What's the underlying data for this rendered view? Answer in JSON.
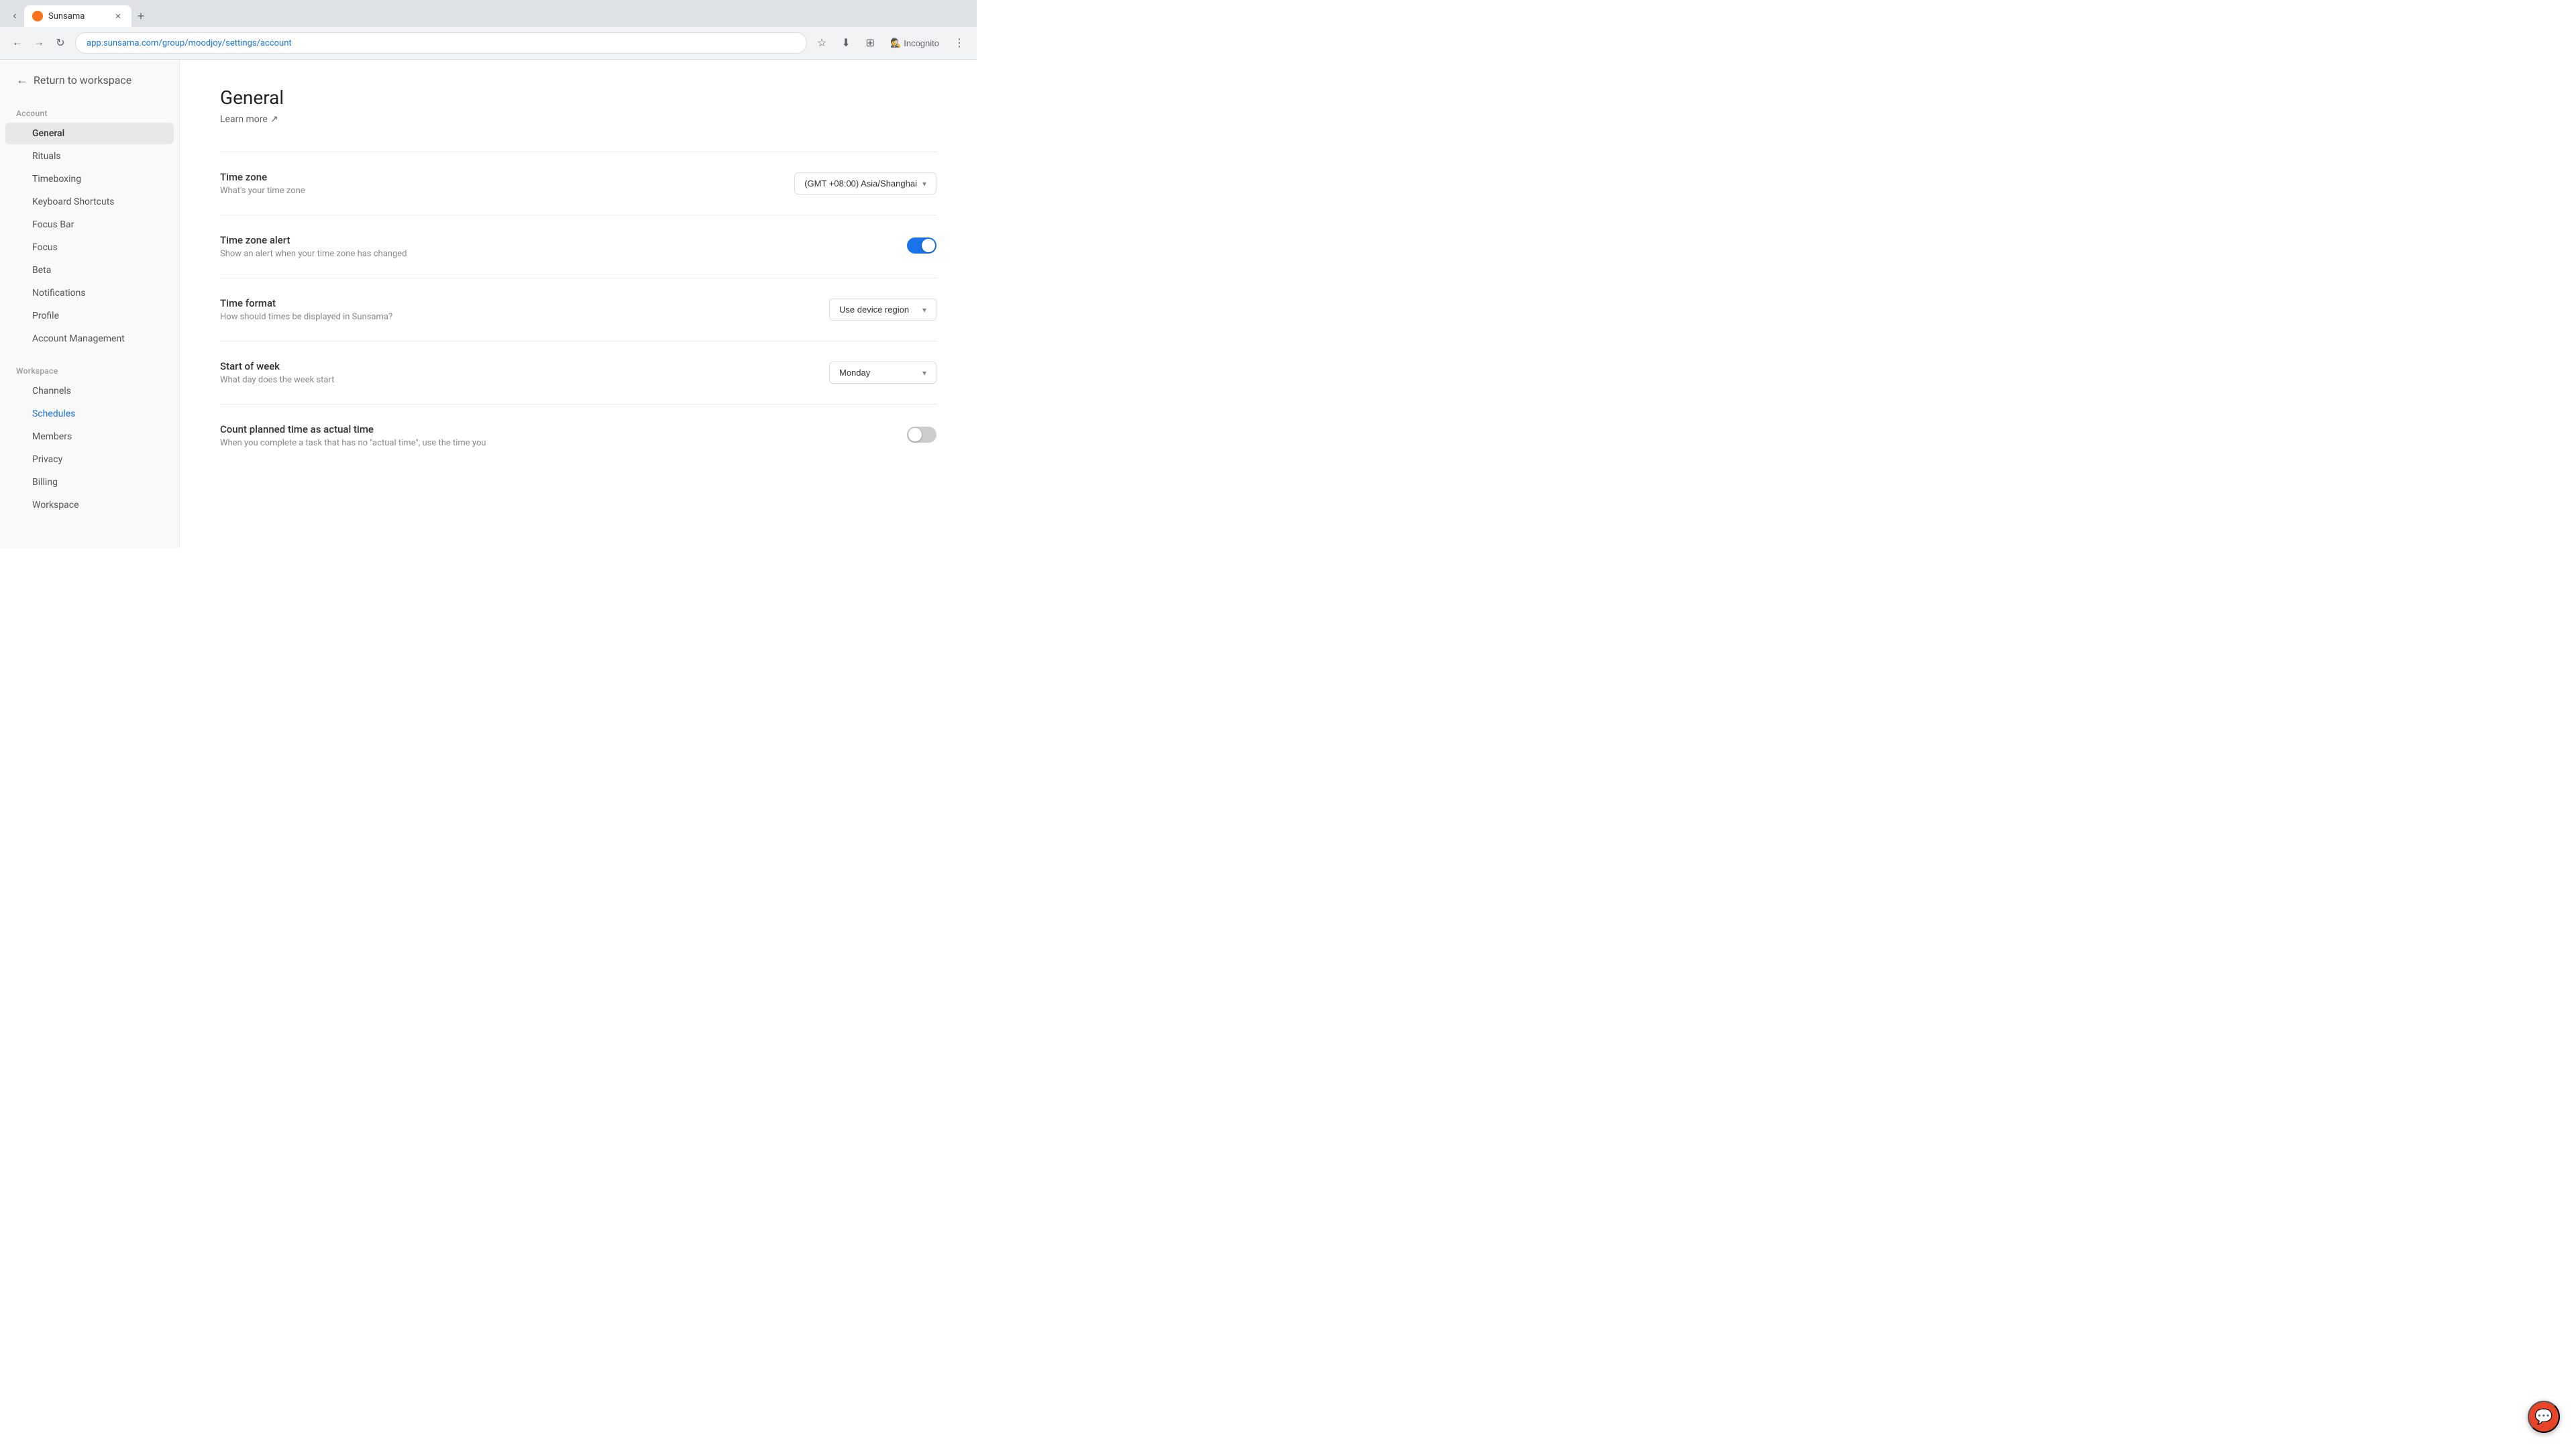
{
  "browser": {
    "tab_title": "Sunsama",
    "tab_favicon_color": "#f97316",
    "url": "app.sunsama.com/group/moodjoy/settings/account",
    "incognito_label": "Incognito"
  },
  "return_link": {
    "label": "Return to workspace"
  },
  "sidebar": {
    "account_section_label": "Account",
    "workspace_section_label": "Workspace",
    "account_items": [
      {
        "id": "general",
        "label": "General",
        "active": true
      },
      {
        "id": "rituals",
        "label": "Rituals",
        "active": false
      },
      {
        "id": "timeboxing",
        "label": "Timeboxing",
        "active": false
      },
      {
        "id": "keyboard-shortcuts",
        "label": "Keyboard Shortcuts",
        "active": false
      },
      {
        "id": "focus-bar",
        "label": "Focus Bar",
        "active": false
      },
      {
        "id": "focus",
        "label": "Focus",
        "active": false
      },
      {
        "id": "beta",
        "label": "Beta",
        "active": false
      },
      {
        "id": "notifications",
        "label": "Notifications",
        "active": false
      },
      {
        "id": "profile",
        "label": "Profile",
        "active": false
      },
      {
        "id": "account-management",
        "label": "Account Management",
        "active": false
      }
    ],
    "workspace_items": [
      {
        "id": "channels",
        "label": "Channels",
        "active": false
      },
      {
        "id": "schedules",
        "label": "Schedules",
        "active": false,
        "link": true
      },
      {
        "id": "members",
        "label": "Members",
        "active": false
      },
      {
        "id": "privacy",
        "label": "Privacy",
        "active": false
      },
      {
        "id": "billing",
        "label": "Billing",
        "active": false
      },
      {
        "id": "workspace",
        "label": "Workspace",
        "active": false
      }
    ]
  },
  "main": {
    "page_title": "General",
    "learn_more_label": "Learn more",
    "settings": [
      {
        "id": "timezone",
        "label": "Time zone",
        "description": "What's your time zone",
        "control_type": "dropdown",
        "value": "(GMT +08:00) Asia/Shanghai"
      },
      {
        "id": "timezone-alert",
        "label": "Time zone alert",
        "description": "Show an alert when your time zone has changed",
        "control_type": "toggle",
        "value": "on"
      },
      {
        "id": "time-format",
        "label": "Time format",
        "description": "How should times be displayed in Sunsama?",
        "control_type": "dropdown",
        "value": "Use device region"
      },
      {
        "id": "start-of-week",
        "label": "Start of week",
        "description": "What day does the week start",
        "control_type": "dropdown",
        "value": "Monday"
      },
      {
        "id": "count-planned-time",
        "label": "Count planned time as actual time",
        "description": "When you complete a task that has no \"actual time\", use the time you",
        "control_type": "toggle",
        "value": "off"
      }
    ]
  }
}
